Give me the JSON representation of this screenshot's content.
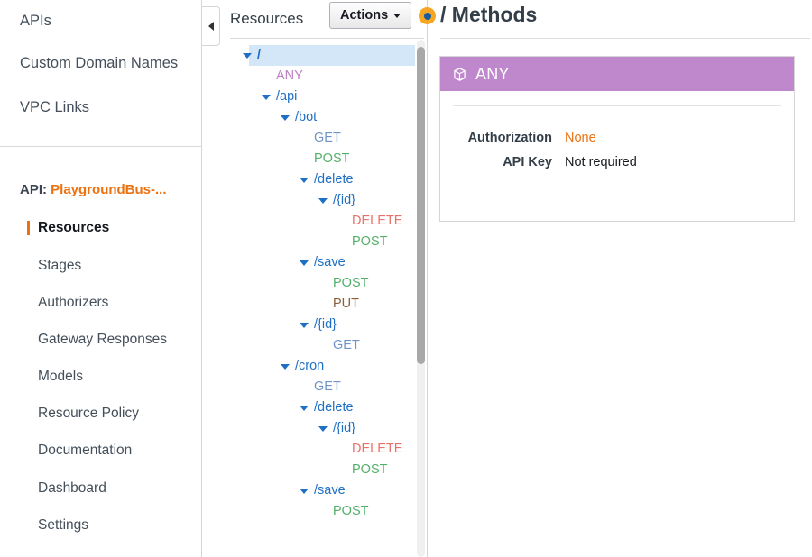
{
  "left_nav": {
    "top_links": [
      {
        "id": "apis",
        "label": "APIs"
      },
      {
        "id": "cdn",
        "label": "Custom Domain Names"
      },
      {
        "id": "vpc",
        "label": "VPC Links"
      }
    ],
    "api_prefix": "API:",
    "api_name": "PlaygroundBus-...",
    "items": [
      {
        "id": "resources",
        "label": "Resources",
        "active": true
      },
      {
        "id": "stages",
        "label": "Stages",
        "active": false
      },
      {
        "id": "authorizers",
        "label": "Authorizers",
        "active": false
      },
      {
        "id": "gatewayresp",
        "label": "Gateway Responses",
        "active": false
      },
      {
        "id": "models",
        "label": "Models",
        "active": false
      },
      {
        "id": "resourcepolicy",
        "label": "Resource Policy",
        "active": false
      },
      {
        "id": "documentation",
        "label": "Documentation",
        "active": false
      },
      {
        "id": "dashboard",
        "label": "Dashboard",
        "active": false
      },
      {
        "id": "settings",
        "label": "Settings",
        "active": false
      }
    ],
    "collapse_icon": "triangle-left-icon"
  },
  "resources_panel": {
    "title": "Resources",
    "actions_button": "Actions",
    "actions_caret_icon": "caret-down-icon",
    "tree": [
      {
        "type": "resource",
        "label": "/",
        "depth": 0,
        "expanded": true,
        "selected": true
      },
      {
        "type": "method",
        "label": "ANY",
        "depth": 1,
        "method": "ANY"
      },
      {
        "type": "resource",
        "label": "/api",
        "depth": 1,
        "expanded": true,
        "selected": false
      },
      {
        "type": "resource",
        "label": "/bot",
        "depth": 2,
        "expanded": true,
        "selected": false
      },
      {
        "type": "method",
        "label": "GET",
        "depth": 3,
        "method": "GET"
      },
      {
        "type": "method",
        "label": "POST",
        "depth": 3,
        "method": "POST"
      },
      {
        "type": "resource",
        "label": "/delete",
        "depth": 3,
        "expanded": true,
        "selected": false
      },
      {
        "type": "resource",
        "label": "/{id}",
        "depth": 4,
        "expanded": true,
        "selected": false
      },
      {
        "type": "method",
        "label": "DELETE",
        "depth": 5,
        "method": "DELETE"
      },
      {
        "type": "method",
        "label": "POST",
        "depth": 5,
        "method": "POST"
      },
      {
        "type": "resource",
        "label": "/save",
        "depth": 3,
        "expanded": true,
        "selected": false
      },
      {
        "type": "method",
        "label": "POST",
        "depth": 4,
        "method": "POST"
      },
      {
        "type": "method",
        "label": "PUT",
        "depth": 4,
        "method": "PUT"
      },
      {
        "type": "resource",
        "label": "/{id}",
        "depth": 3,
        "expanded": true,
        "selected": false
      },
      {
        "type": "method",
        "label": "GET",
        "depth": 4,
        "method": "GET"
      },
      {
        "type": "resource",
        "label": "/cron",
        "depth": 2,
        "expanded": true,
        "selected": false
      },
      {
        "type": "method",
        "label": "GET",
        "depth": 3,
        "method": "GET"
      },
      {
        "type": "resource",
        "label": "/delete",
        "depth": 3,
        "expanded": true,
        "selected": false
      },
      {
        "type": "resource",
        "label": "/{id}",
        "depth": 4,
        "expanded": true,
        "selected": false
      },
      {
        "type": "method",
        "label": "DELETE",
        "depth": 5,
        "method": "DELETE"
      },
      {
        "type": "method",
        "label": "POST",
        "depth": 5,
        "method": "POST"
      },
      {
        "type": "resource",
        "label": "/save",
        "depth": 3,
        "expanded": true,
        "selected": false
      },
      {
        "type": "method",
        "label": "POST",
        "depth": 4,
        "method": "POST"
      }
    ]
  },
  "methods_panel": {
    "title": "/ Methods",
    "method_card": {
      "icon": "cube-icon",
      "name": "ANY",
      "rows": [
        {
          "key": "Authorization",
          "value": "None",
          "is_link": true
        },
        {
          "key": "API Key",
          "value": "Not required",
          "is_link": false
        }
      ]
    }
  },
  "colors": {
    "accent_orange": "#ec7211",
    "resource_blue": "#1f6fc4",
    "selected_row": "#d3e7f9",
    "method_ANY": "#bd7fc4",
    "method_GET": "#7094c9",
    "method_POST": "#53b06a",
    "method_PUT": "#8a6038",
    "method_DELETE": "#e8726b",
    "any_header_bg": "#bf88cc",
    "splitter_knob": "#f6a623"
  }
}
